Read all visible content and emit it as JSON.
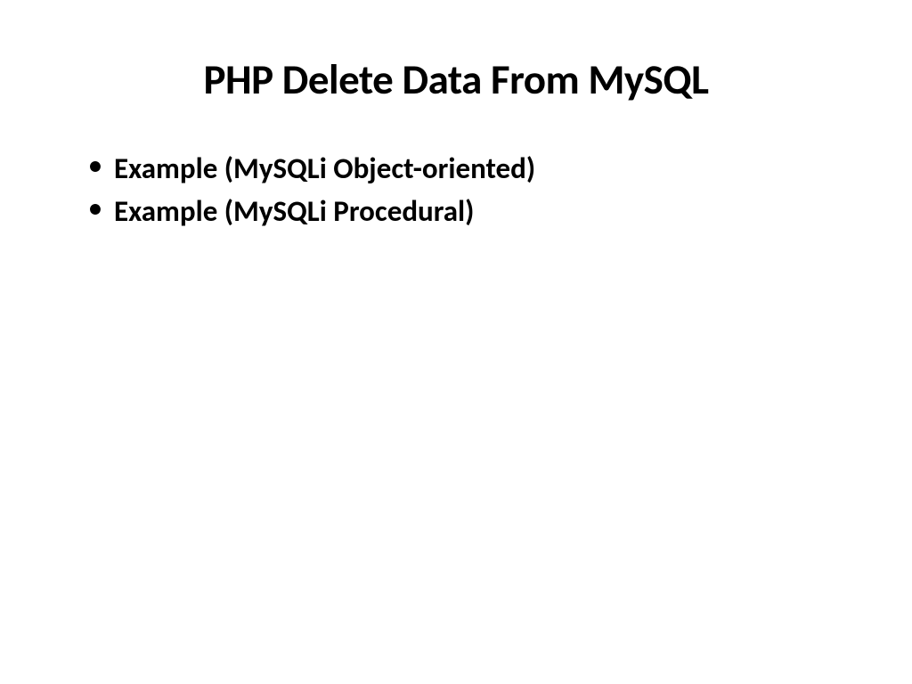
{
  "slide": {
    "title": "PHP Delete Data From MySQL",
    "bullets": [
      "Example (MySQLi Object-oriented)",
      "Example (MySQLi Procedural)"
    ]
  }
}
